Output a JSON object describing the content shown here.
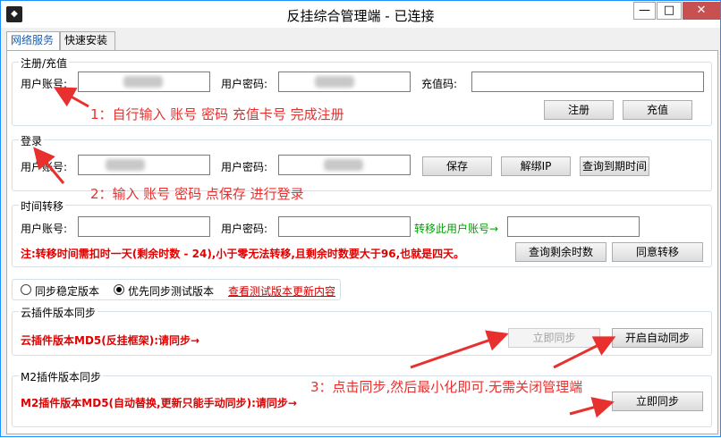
{
  "window": {
    "title": "反挂综合管理端 - 已连接",
    "min": "—",
    "max": "□",
    "close": "✕",
    "app_icon": "app-icon"
  },
  "tabs": [
    {
      "label": "网络服务",
      "active": true
    },
    {
      "label": "快速安装",
      "active": false
    }
  ],
  "register": {
    "legend": "注册/充值",
    "account_label": "用户账号:",
    "password_label": "用户密码:",
    "code_label": "充值码:",
    "register_button": "注册",
    "recharge_button": "充值"
  },
  "login": {
    "legend": "登录",
    "account_label": "用户账号:",
    "password_label": "用户密码:",
    "save_button": "保存",
    "unbind_button": "解绑IP",
    "query_button": "查询到期时间"
  },
  "transfer": {
    "legend": "时间转移",
    "account_label": "用户账号:",
    "password_label": "用户密码:",
    "target_label": "转移此用户账号→",
    "note": "注:转移时间需扣时一天(剩余时数 - 24),小于零无法转移,且剩余时数要大于96,也就是四天。",
    "query_remaining_button": "查询剩余时数",
    "agree_button": "同意转移"
  },
  "version": {
    "option_stable": "同步稳定版本",
    "option_test": "优先同步测试版本",
    "selected": "优先同步测试版本",
    "view_link": "查看测试版本更新内容"
  },
  "cloud": {
    "legend": "云插件版本同步",
    "status": "云插件版本MD5(反挂框架):请同步→",
    "sync_button": "立即同步",
    "auto_button": "开启自动同步"
  },
  "m2": {
    "legend": "M2插件版本同步",
    "status": "M2插件版本MD5(自动替换,更新只能手动同步):请同步→",
    "sync_button": "立即同步"
  },
  "annotations": {
    "step1": "1：自行输入 账号 密码  充值卡号 完成注册",
    "step2": "2：输入 账号 密码 点保存 进行登录",
    "step3": "3：点击同步,然后最小化即可.无需关闭管理端"
  },
  "colors": {
    "accent_red": "#e00000",
    "annotation_red": "#e8302f",
    "green": "#00a000",
    "tab_blue": "#1c5fb0"
  }
}
